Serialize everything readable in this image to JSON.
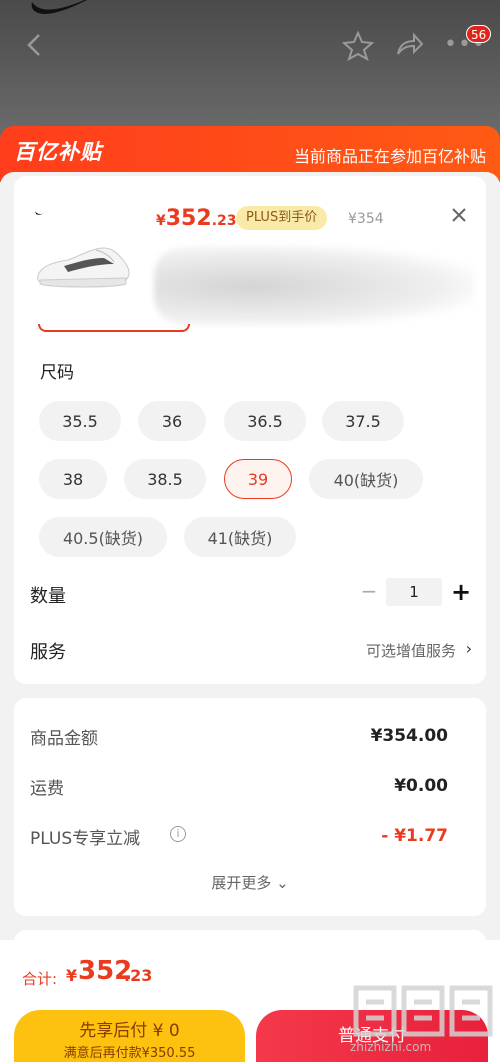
{
  "background_page": {
    "cart_badge": "56"
  },
  "banner": {
    "logo_text": "百亿补贴",
    "text": "当前商品正在参加百亿补贴"
  },
  "product": {
    "price_symbol": "¥",
    "price_int": "352",
    "price_dec": ".23",
    "plus_tag": "PLUS到手价",
    "original_price": "¥354"
  },
  "size": {
    "title": "尺码",
    "options": [
      {
        "label": "35.5"
      },
      {
        "label": "36"
      },
      {
        "label": "36.5"
      },
      {
        "label": "37.5"
      },
      {
        "label": "38"
      },
      {
        "label": "38.5"
      },
      {
        "label": "39",
        "selected": true
      },
      {
        "label": "40(缺货)"
      },
      {
        "label": "40.5(缺货)"
      },
      {
        "label": "41(缺货)"
      }
    ]
  },
  "quantity": {
    "label": "数量",
    "minus": "−",
    "value": "1",
    "plus": "+"
  },
  "service": {
    "label": "服务",
    "option": "可选增值服务",
    "arrow": "›"
  },
  "summary": {
    "rows": [
      {
        "label": "商品金额",
        "value": "¥354.00"
      },
      {
        "label": "运费",
        "value": "¥0.00"
      },
      {
        "label": "PLUS专享立减",
        "value": "- ¥1.77"
      }
    ],
    "info_icon": "i",
    "expand": "展开更多 ⌄"
  },
  "footer": {
    "total_label": "合计:",
    "total_symbol": "¥",
    "total_int": "352",
    "total_dec": ".23",
    "pay_later_main": "先享后付 ¥ 0",
    "pay_later_sub": "满意后再付款¥350.55",
    "pay_button": "普通支付",
    "watermark": "zhizhizhi.com"
  },
  "colors": {
    "accent": "#e93b1f",
    "pay_later": "#fcc20f",
    "pay": "#e8203c"
  }
}
